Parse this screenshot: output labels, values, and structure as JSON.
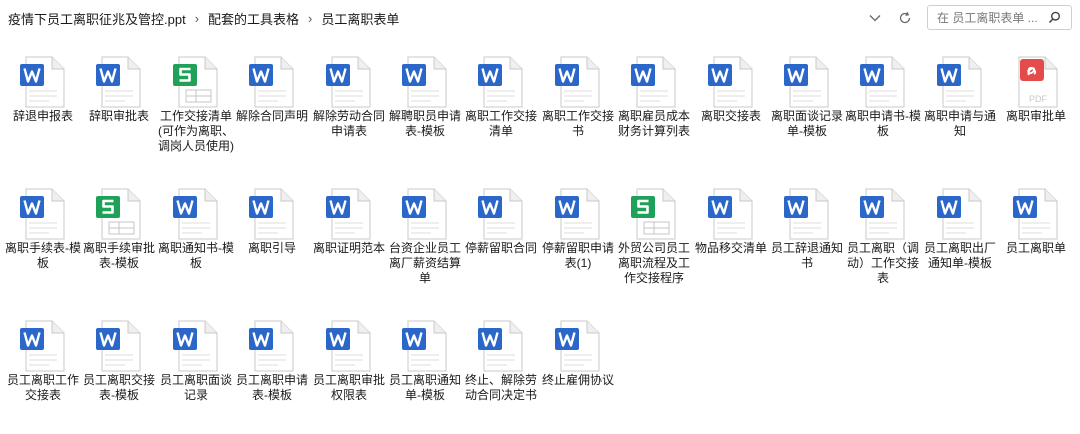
{
  "breadcrumb": [
    "疫情下员工离职征兆及管控.ppt",
    "配套的工具表格",
    "员工离职表单"
  ],
  "search": {
    "placeholder": "在 员工离职表单 ..."
  },
  "colors": {
    "word": "#2b67c8",
    "excel": "#20a15a",
    "pdf": "#e44b4b"
  },
  "files": [
    {
      "name": "辞退申报表",
      "type": "word"
    },
    {
      "name": "辞职审批表",
      "type": "word"
    },
    {
      "name": "工作交接清单(可作为离职、调岗人员使用)",
      "type": "excel"
    },
    {
      "name": "解除合同声明",
      "type": "word"
    },
    {
      "name": "解除劳动合同申请表",
      "type": "word"
    },
    {
      "name": "解聘职员申请表-模板",
      "type": "word"
    },
    {
      "name": "离职工作交接清单",
      "type": "word"
    },
    {
      "name": "离职工作交接书",
      "type": "word"
    },
    {
      "name": "离职雇员成本财务计算列表",
      "type": "word"
    },
    {
      "name": "离职交接表",
      "type": "word"
    },
    {
      "name": "离职面谈记录单-模板",
      "type": "word"
    },
    {
      "name": "离职申请书-模板",
      "type": "word"
    },
    {
      "name": "离职申请与通知",
      "type": "word"
    },
    {
      "name": "离职审批单",
      "type": "pdf"
    },
    {
      "name": "离职手续表-模板",
      "type": "word"
    },
    {
      "name": "离职手续审批表-模板",
      "type": "excel"
    },
    {
      "name": "离职通知书-模板",
      "type": "word"
    },
    {
      "name": "离职引导",
      "type": "word"
    },
    {
      "name": "离职证明范本",
      "type": "word"
    },
    {
      "name": "台资企业员工离厂薪资结算单",
      "type": "word"
    },
    {
      "name": "停薪留职合同",
      "type": "word"
    },
    {
      "name": "停薪留职申请表(1)",
      "type": "word"
    },
    {
      "name": "外贸公司员工离职流程及工作交接程序",
      "type": "excel"
    },
    {
      "name": "物品移交清单",
      "type": "word"
    },
    {
      "name": "员工辞退通知书",
      "type": "word"
    },
    {
      "name": "员工离职（调动）工作交接表",
      "type": "word"
    },
    {
      "name": "员工离职出厂通知单-模板",
      "type": "word"
    },
    {
      "name": "员工离职单",
      "type": "word"
    },
    {
      "name": "员工离职工作交接表",
      "type": "word"
    },
    {
      "name": "员工离职交接表-模板",
      "type": "word"
    },
    {
      "name": "员工离职面谈记录",
      "type": "word"
    },
    {
      "name": "员工离职申请表-模板",
      "type": "word"
    },
    {
      "name": "员工离职审批权限表",
      "type": "word"
    },
    {
      "name": "员工离职通知单-模板",
      "type": "word"
    },
    {
      "name": "终止、解除劳动合同决定书",
      "type": "word"
    },
    {
      "name": "终止雇佣协议",
      "type": "word"
    }
  ]
}
